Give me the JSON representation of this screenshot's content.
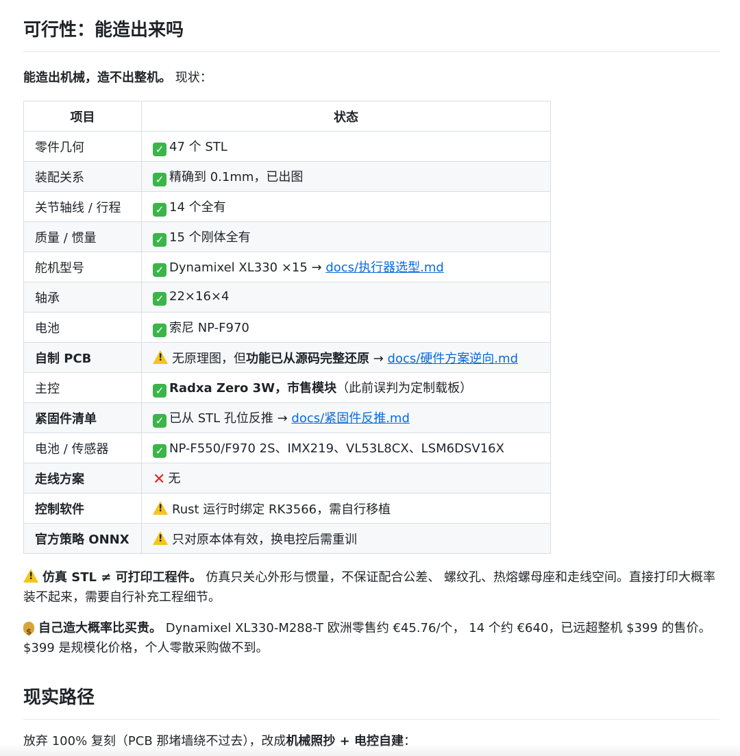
{
  "heading1": "可行性：能造出来吗",
  "intro": {
    "bold": "能造出机械，造不出整机。",
    "rest": " 现状："
  },
  "table": {
    "headers": [
      "项目",
      "状态"
    ],
    "rows": [
      {
        "item": "零件几何",
        "bold": false,
        "icon": "ok",
        "text": "47 个 STL"
      },
      {
        "item": "装配关系",
        "bold": false,
        "icon": "ok",
        "text": "精确到 0.1mm，已出图"
      },
      {
        "item": "关节轴线 / 行程",
        "bold": false,
        "icon": "ok",
        "text": "14 个全有"
      },
      {
        "item": "质量 / 惯量",
        "bold": false,
        "icon": "ok",
        "text": "15 个刚体全有"
      },
      {
        "item": "舵机型号",
        "bold": false,
        "icon": "ok",
        "text": "Dynamixel XL330 ×15 → ",
        "link": "docs/执行器选型.md"
      },
      {
        "item": "轴承",
        "bold": false,
        "icon": "ok",
        "text": "22×16×4"
      },
      {
        "item": "电池",
        "bold": false,
        "icon": "ok",
        "text": "索尼 NP-F970"
      },
      {
        "item": "自制 PCB",
        "bold": true,
        "icon": "warn",
        "text": "无原理图，但",
        "text_bold": "功能已从源码完整还原",
        "text_after": " → ",
        "link": "docs/硬件方案逆向.md"
      },
      {
        "item": "主控",
        "bold": false,
        "icon": "ok",
        "text_bold": "Radxa Zero 3W，市售模块",
        "text_after": "（此前误判为定制载板）"
      },
      {
        "item": "紧固件清单",
        "bold": true,
        "icon": "ok",
        "text": "已从 STL 孔位反推 → ",
        "link": "docs/紧固件反推.md"
      },
      {
        "item": "电池 / 传感器",
        "bold": false,
        "icon": "ok",
        "text": "NP-F550/F970 2S、IMX219、VL53L8CX、LSM6DSV16X"
      },
      {
        "item": "走线方案",
        "bold": true,
        "icon": "cross",
        "text": "无"
      },
      {
        "item": "控制软件",
        "bold": true,
        "icon": "warn",
        "text": "Rust 运行时绑定 RK3566，需自行移植"
      },
      {
        "item": "官方策略 ONNX",
        "bold": true,
        "icon": "warn",
        "text": "只对原本体有效，换电控后需重训"
      }
    ]
  },
  "note1": {
    "bold": "仿真 STL ≠ 可打印工程件。",
    "text": " 仿真只关心外形与惯量，不保证配合公差、 螺纹孔、热熔螺母座和走线空间。直接打印大概率装不起来，需要自行补充工程细节。"
  },
  "note2": {
    "bold": "自己造大概率比买贵。",
    "text": " Dynamixel XL330-M288-T 欧洲零售约 €45.76/个， 14 个约 €640，已远超整机 $399 的售价。$399 是规模化价格，个人零散采购做不到。"
  },
  "heading2": "现实路径",
  "last": {
    "a": "放弃 100% 复刻（PCB 那堵墙绕不过去），改成",
    "b": "机械照抄 + 电控自建",
    "c": "："
  },
  "icons": {
    "ok": "check-box-icon",
    "warn": "warning-icon",
    "cross": "cross-icon",
    "money": "money-bag-icon"
  },
  "colors": {
    "link": "#0969da",
    "ok": "#3bb54a",
    "warn": "#f5c518",
    "cross": "#e02424",
    "stripe": "#f6f8fa"
  }
}
